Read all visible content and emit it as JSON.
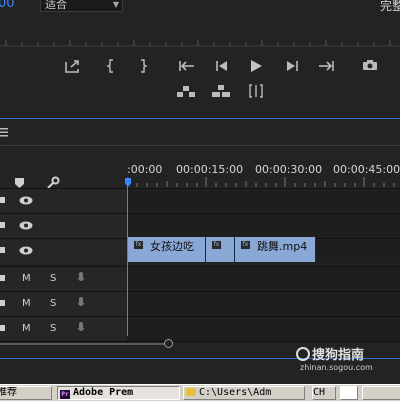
{
  "monitor": {
    "timecode_fragment": "00",
    "fit_dropdown": "适合",
    "quality_label": "完整",
    "transport": {
      "row1": [
        "export-frame-icon",
        "mark-in-icon",
        "mark-out-icon",
        "go-to-in-icon",
        "step-back-icon",
        "play-icon",
        "step-forward-icon",
        "go-to-out-icon",
        "camera-icon"
      ],
      "row2": [
        "lift-icon",
        "extract-icon",
        "trim-icon"
      ]
    }
  },
  "timeline": {
    "ruler_labels": [
      ":00:00",
      "00:00:15:00",
      "00:00:30:00",
      "00:00:45:00"
    ],
    "header_icons": [
      "marker-icon",
      "wrench-icon"
    ],
    "video_tracks": 3,
    "audio_tracks": [
      {
        "mute": "M",
        "solo": "S"
      },
      {
        "mute": "M",
        "solo": "S"
      },
      {
        "mute": "M",
        "solo": "S"
      }
    ],
    "clips": [
      {
        "name": "女孩边吃"
      },
      {
        "name": ""
      },
      {
        "name": "跳舞.mp4"
      }
    ]
  },
  "watermark": {
    "text": "搜狗指南",
    "url": "zhinan.sogou.com"
  },
  "taskbar": {
    "items": [
      "推荐",
      "Adobe Prem",
      "C:\\Users\\Adm",
      "CH"
    ]
  },
  "colors": {
    "accent": "#3a86ff",
    "work_area_yellow": "#d6c400",
    "work_area_red": "#c8222a",
    "clip_fill": "#8aa8d6",
    "panel_bg": "#232323"
  }
}
